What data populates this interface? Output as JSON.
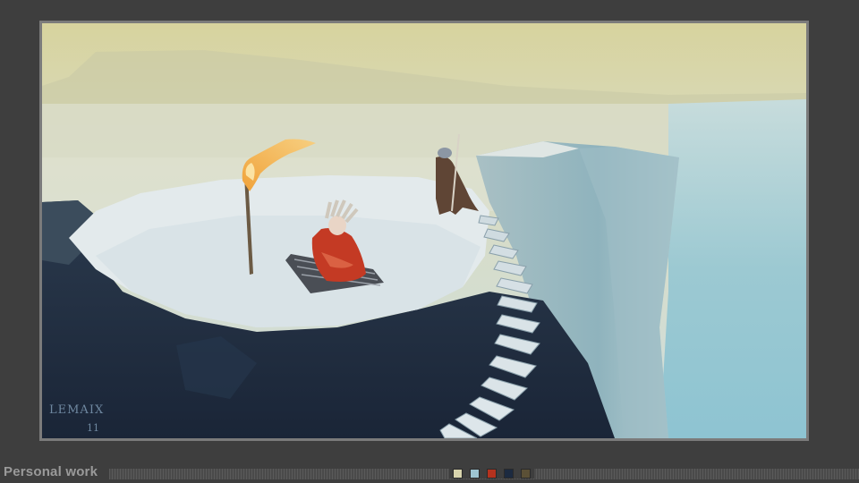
{
  "caption": "Personal work",
  "signature": {
    "name": "LEMAIX",
    "year": "11"
  },
  "palette": [
    {
      "name": "cream",
      "color": "#d8d4ad"
    },
    {
      "name": "pale-blue",
      "color": "#9ec5d2"
    },
    {
      "name": "red",
      "color": "#b5321e"
    },
    {
      "name": "navy",
      "color": "#1c2a40"
    },
    {
      "name": "olive-brown",
      "color": "#5b5036"
    }
  ],
  "icons": [
    "artwork-painting",
    "color-swatch"
  ]
}
